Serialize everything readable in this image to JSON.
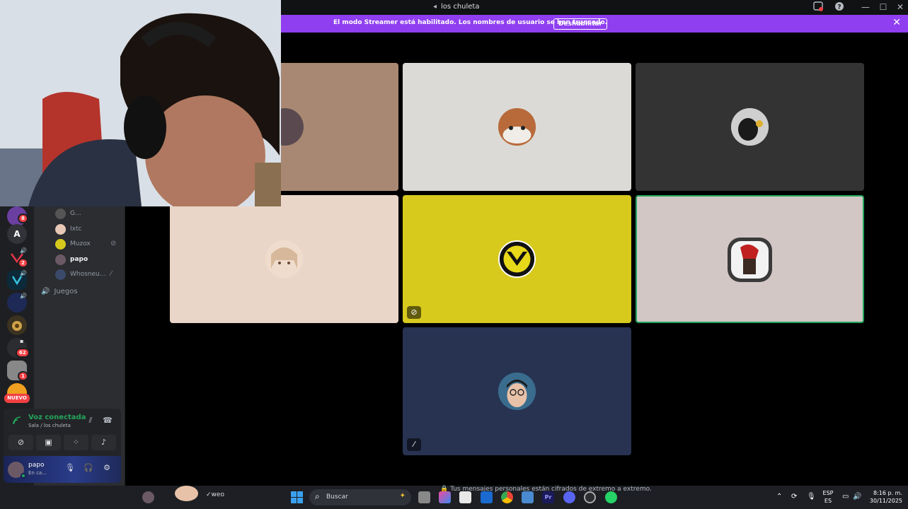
{
  "window": {
    "title": "los chuleta"
  },
  "streamer_banner": {
    "message": "El modo Streamer está habilitado. Los nombres de usuario se han truncado.",
    "button": "Deshabilitar"
  },
  "servers": {
    "badges": [
      "8",
      "2",
      "62",
      "1"
    ],
    "letter": "A",
    "new_label": "NUEVO"
  },
  "members": [
    {
      "name": "G...",
      "bold": false
    },
    {
      "name": "Ixtc",
      "bold": false
    },
    {
      "name": "Muzox",
      "bold": false
    },
    {
      "name": "papo",
      "bold": true
    },
    {
      "name": "Whosneu...",
      "bold": false
    }
  ],
  "category": "Juegos",
  "voice": {
    "status": "Voz conectada",
    "location": "Sala / los chuleta"
  },
  "user": {
    "name": "papo",
    "status": "En ca..."
  },
  "taskbar": {
    "search_placeholder": "Buscar",
    "chat_preview": "weo",
    "encryption_notice": "Tus mensajes personales están cifrados de extremo a extremo.",
    "lang_1": "ESP",
    "lang_2": "ES",
    "time": "8:16 p. m.",
    "date": "30/11/2025"
  },
  "colors": {
    "streamer_bar": "#8f3ff0",
    "voice_connected": "#23a55a",
    "tile_brown": "#a98873",
    "tile_light_gray": "#dcdad6",
    "tile_dark_gray": "#333333",
    "tile_peach": "#ead6c9",
    "tile_yellow": "#d7ca1d",
    "tile_pink_gray": "#d3c7c6",
    "tile_navy": "#283352",
    "speaking_border": "#23a55a"
  }
}
